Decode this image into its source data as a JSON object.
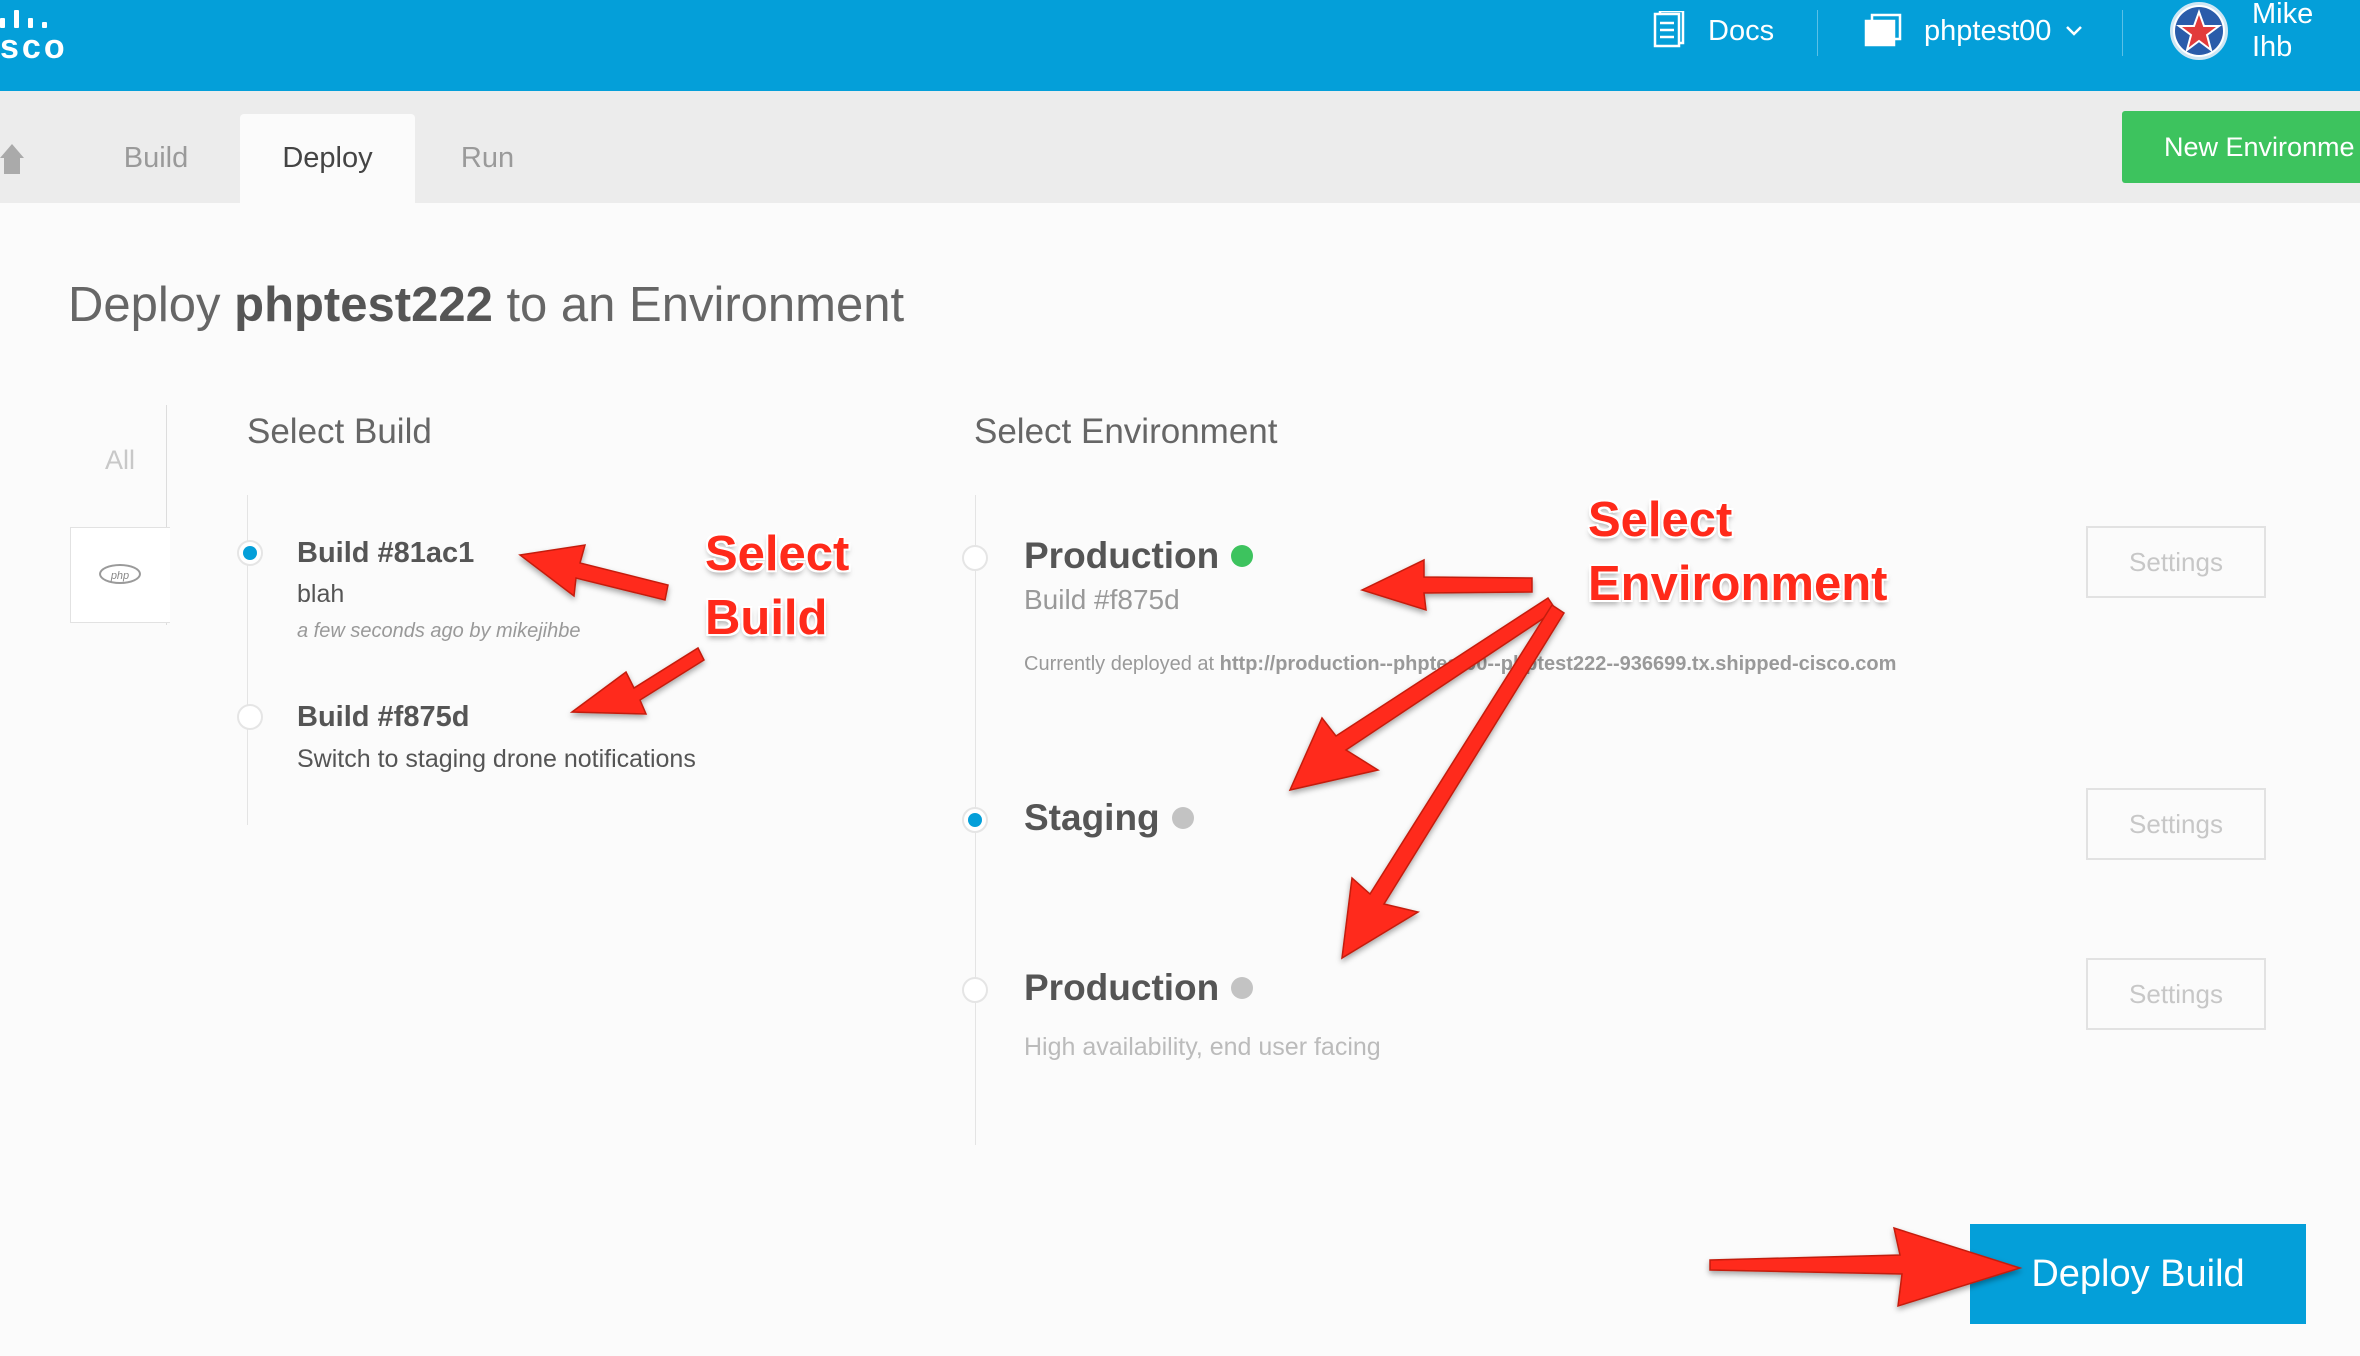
{
  "header": {
    "logo_text": "sco",
    "docs_label": "Docs",
    "project_label": "phptest00",
    "user_name": "Mike Ihb"
  },
  "tabs": [
    {
      "label": "Build",
      "active": false
    },
    {
      "label": "Deploy",
      "active": true
    },
    {
      "label": "Run",
      "active": false
    }
  ],
  "new_environment_label": "New Environme",
  "page": {
    "title_prefix": "Deploy ",
    "title_project": "phptest222",
    "title_suffix": " to an Environment"
  },
  "filter": {
    "all_label": "All",
    "php_label": "php"
  },
  "builds": {
    "section_title": "Select Build",
    "items": [
      {
        "title": "Build #81ac1",
        "description": "blah",
        "meta": "a few seconds ago by mikejihbe",
        "selected": true
      },
      {
        "title": "Build #f875d",
        "description": "Switch to staging drone notifications",
        "selected": false
      }
    ]
  },
  "environments": {
    "section_title": "Select Environment",
    "settings_label": "Settings",
    "items": [
      {
        "name": "Production",
        "status_color": "#3dc35e",
        "subtitle": "Build #f875d",
        "deployed_prefix": "Currently deployed at ",
        "deployed_url": "http://production--phptest00--phptest222--936699.tx.shipped-cisco.com",
        "selected": false
      },
      {
        "name": "Staging",
        "status_color": "#c3c3c3",
        "selected": true
      },
      {
        "name": "Production",
        "status_color": "#c3c3c3",
        "subtitle": "High availability, end user facing",
        "selected": false
      }
    ]
  },
  "deploy_button_label": "Deploy Build",
  "annotations": {
    "select_build_line1": "Select",
    "select_build_line2": "Build",
    "select_env_line1": "Select",
    "select_env_line2": "Environment"
  },
  "colors": {
    "brand_blue": "#049fd9",
    "success_green": "#3dc35e",
    "annotation_red": "#ff2a1a"
  }
}
